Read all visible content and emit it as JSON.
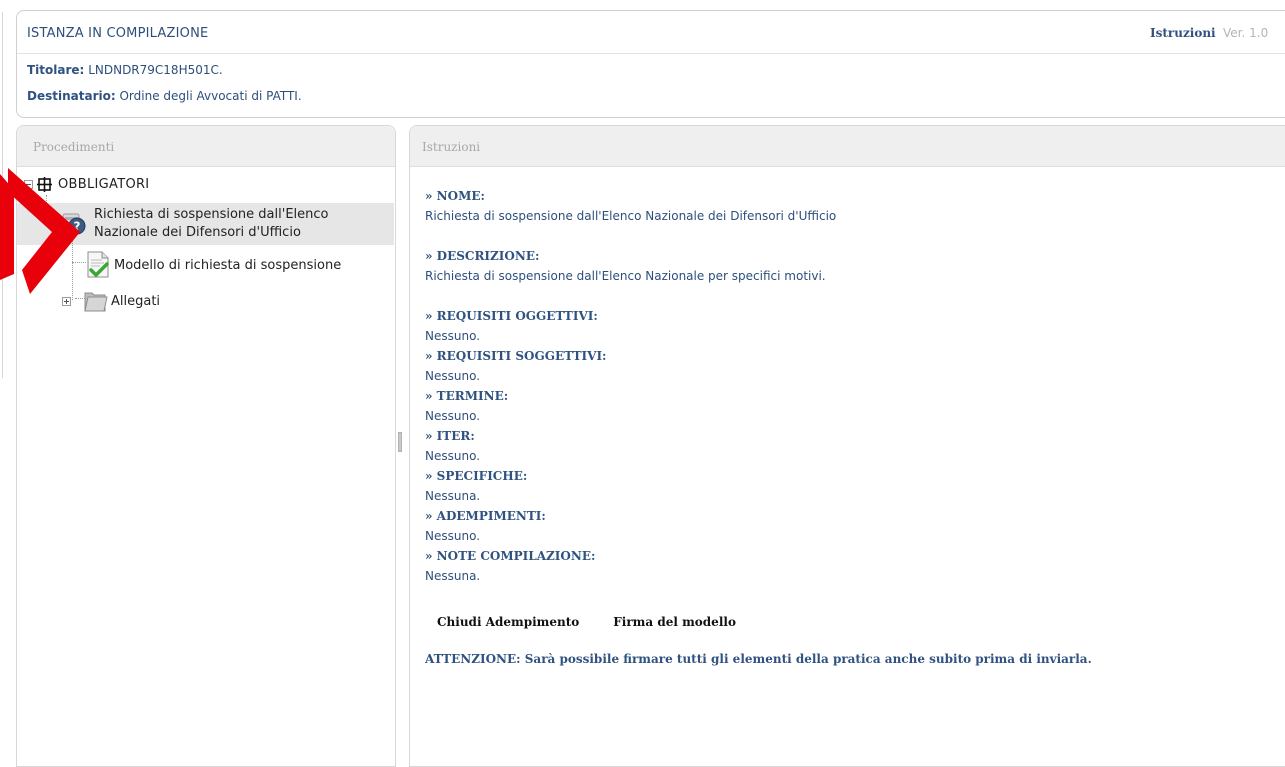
{
  "header": {
    "title": "ISTANZA IN COMPILAZIONE",
    "instructions_link": "Istruzioni",
    "version": "Ver. 1.0",
    "holder_label": "Titolare:",
    "holder_value": "LNDNDR79C18H501C.",
    "recipient_label": "Destinatario:",
    "recipient_value": "Ordine degli Avvocati di PATTI."
  },
  "left_panel": {
    "title": "Procedimenti",
    "tree": {
      "root_label": "OBBLIGATORI",
      "selected_label": "Richiesta di sospensione dall'Elenco\nNazionale dei Difensori d'Ufficio",
      "model_label": "Modello di richiesta di sospensione",
      "attachments_label": "Allegati"
    }
  },
  "right_panel": {
    "title": "Istruzioni",
    "sections": {
      "nome_h": "» NOME:",
      "nome_v": "Richiesta di sospensione dall'Elenco Nazionale dei Difensori d'Ufficio",
      "descr_h": "» DESCRIZIONE:",
      "descr_v": "Richiesta di sospensione dall'Elenco Nazionale per specifici motivi.",
      "req_ogg_h": "» REQUISITI OGGETTIVI:",
      "req_ogg_v": "Nessuno.",
      "req_sogg_h": "» REQUISITI SOGGETTIVI:",
      "req_sogg_v": "Nessuno.",
      "termine_h": "» TERMINE:",
      "termine_v": "Nessuno.",
      "iter_h": "» ITER:",
      "iter_v": "Nessuno.",
      "specifiche_h": "» SPECIFICHE:",
      "specifiche_v": "Nessuna.",
      "adempimenti_h": "» ADEMPIMENTI:",
      "adempimenti_v": "Nessuno.",
      "note_h": "» NOTE COMPILAZIONE:",
      "note_v": "Nessuna."
    },
    "actions": {
      "close": "Chiudi Adempimento",
      "sign": "Firma del modello"
    },
    "warning": "ATTENZIONE: Sarà possibile firmare tutti gli elementi della pratica anche subito prima di inviarla."
  },
  "icons": {
    "root": "grid-icon",
    "selected": "question-gear-icon",
    "model": "signed-document-icon",
    "attachments": "folder-icon",
    "annotation": "red-arrow"
  },
  "colors": {
    "accent": "#2f5280",
    "annotation": "#e8000b"
  }
}
